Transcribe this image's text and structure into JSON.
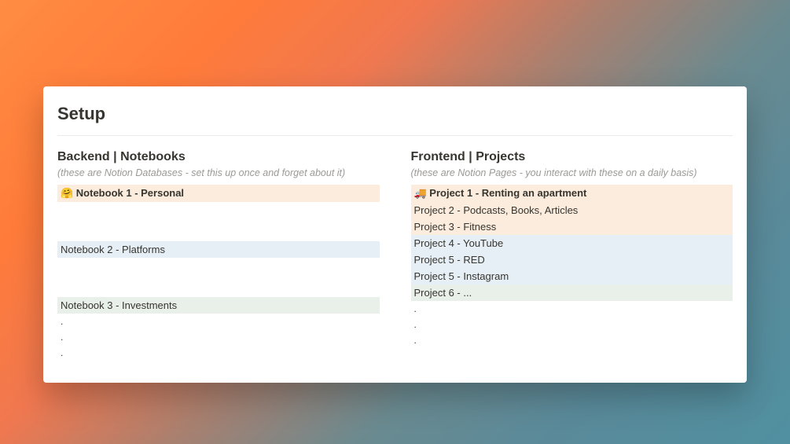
{
  "title": "Setup",
  "left": {
    "heading": "Backend | Notebooks",
    "sub": "(these are Notion Databases - set this up once and forget about it)",
    "rows": [
      {
        "text": "🤗 Notebook 1 - Personal",
        "color": "orange",
        "bold": true
      },
      {
        "text": "",
        "color": "spacer"
      },
      {
        "text": "Notebook 2 - Platforms",
        "color": "blue"
      },
      {
        "text": "",
        "color": "spacer"
      },
      {
        "text": "Notebook 3 - Investments",
        "color": "green"
      },
      {
        "text": ".",
        "color": "dot"
      },
      {
        "text": ".",
        "color": "dot"
      },
      {
        "text": ".",
        "color": "dot"
      }
    ]
  },
  "right": {
    "heading": "Frontend | Projects",
    "sub": "(these are Notion Pages - you interact with these on a daily basis)",
    "rows": [
      {
        "text": "🚚 Project 1 - Renting an apartment",
        "color": "orange",
        "bold": true
      },
      {
        "text": "Project 2 - Podcasts, Books, Articles",
        "color": "orange"
      },
      {
        "text": "Project 3 - Fitness",
        "color": "orange"
      },
      {
        "text": "Project 4 - YouTube",
        "color": "blue"
      },
      {
        "text": "Project 5 - RED",
        "color": "blue"
      },
      {
        "text": "Project 5 - Instagram",
        "color": "blue"
      },
      {
        "text": "Project 6 - ...",
        "color": "green"
      },
      {
        "text": ".",
        "color": "dot"
      },
      {
        "text": ".",
        "color": "dot"
      },
      {
        "text": ".",
        "color": "dot"
      }
    ]
  }
}
